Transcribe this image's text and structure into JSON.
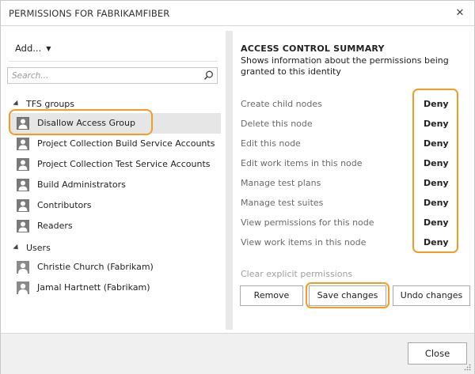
{
  "dialog": {
    "title": "PERMISSIONS FOR FABRIKAMFIBER",
    "close_glyph": "✕"
  },
  "left": {
    "add_label": "Add...",
    "search_placeholder": "Search...",
    "groups": [
      {
        "label": "TFS groups",
        "items": [
          {
            "label": "Disallow Access Group",
            "selected": true
          },
          {
            "label": "Project Collection Build Service Accounts"
          },
          {
            "label": "Project Collection Test Service Accounts"
          },
          {
            "label": "Build Administrators"
          },
          {
            "label": "Contributors"
          },
          {
            "label": "Readers"
          }
        ]
      },
      {
        "label": "Users",
        "items": [
          {
            "label": "Christie Church (Fabrikam)"
          },
          {
            "label": "Jamal Hartnett (Fabrikam)"
          }
        ]
      }
    ]
  },
  "right": {
    "summary_title": "ACCESS CONTROL SUMMARY",
    "summary_desc": "Shows information about the permissions being granted to this identity",
    "permissions": [
      {
        "name": "Create child nodes",
        "value": "Deny"
      },
      {
        "name": "Delete this node",
        "value": "Deny"
      },
      {
        "name": "Edit this node",
        "value": "Deny"
      },
      {
        "name": "Edit work items in this node",
        "value": "Deny"
      },
      {
        "name": "Manage test plans",
        "value": "Deny"
      },
      {
        "name": "Manage test suites",
        "value": "Deny"
      },
      {
        "name": "View permissions for this node",
        "value": "Deny"
      },
      {
        "name": "View work items in this node",
        "value": "Deny"
      }
    ],
    "clear_label": "Clear explicit permissions",
    "remove_label": "Remove",
    "save_label": "Save changes",
    "undo_label": "Undo changes"
  },
  "footer": {
    "close_label": "Close"
  },
  "colors": {
    "highlight": "#f39c24",
    "selected_bg": "#e6e6e6",
    "muted_text": "#6a6a6a"
  },
  "icons": {
    "close": "close-icon",
    "add_dropdown": "caret-down-icon",
    "search": "search-icon",
    "group_expand": "triangle-expanded-icon",
    "group_avatar": "group-icon",
    "user_avatar": "user-icon",
    "resize": "resize-grip-icon"
  }
}
